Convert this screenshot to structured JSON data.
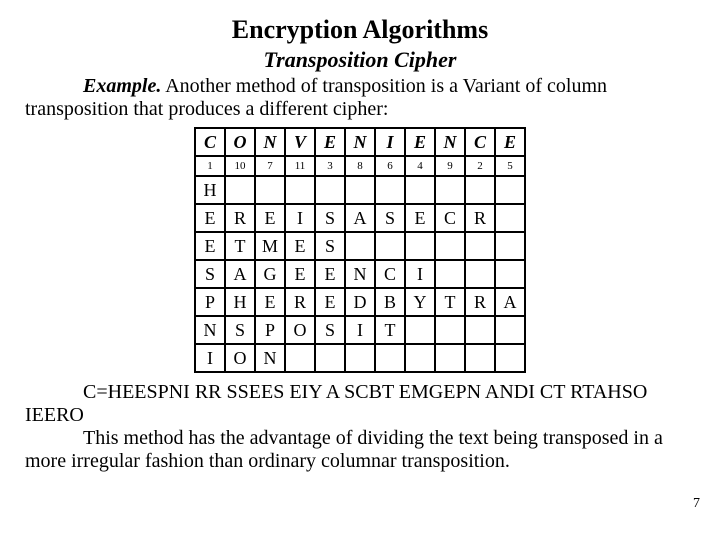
{
  "title": "Encryption Algorithms",
  "subtitle": "Transposition Cipher",
  "example_label": "Example.",
  "para1": " Another method of transposition is a Variant of column transposition that produces a different cipher:",
  "key_row": [
    "C",
    "O",
    "N",
    "V",
    "E",
    "N",
    "I",
    "E",
    "N",
    "C",
    "E"
  ],
  "num_row": [
    "1",
    "10",
    "7",
    "11",
    "3",
    "8",
    "6",
    "4",
    "9",
    "2",
    "5"
  ],
  "rows": [
    [
      "H",
      "",
      "",
      "",
      "",
      "",
      "",
      "",
      "",
      "",
      ""
    ],
    [
      "E",
      "R",
      "E",
      "I",
      "S",
      "A",
      "S",
      "E",
      "C",
      "R",
      ""
    ],
    [
      "E",
      "T",
      "M",
      "E",
      "S",
      "",
      "",
      "",
      "",
      "",
      ""
    ],
    [
      "S",
      "A",
      "G",
      "E",
      "E",
      "N",
      "C",
      "I",
      "",
      "",
      ""
    ],
    [
      "P",
      "H",
      "E",
      "R",
      "E",
      "D",
      "B",
      "Y",
      "T",
      "R",
      "A"
    ],
    [
      "N",
      "S",
      "P",
      "O",
      "S",
      "I",
      "T",
      "",
      "",
      "",
      ""
    ],
    [
      "I",
      "O",
      "N",
      "",
      "",
      "",
      "",
      "",
      "",
      "",
      ""
    ]
  ],
  "cipher_line": "C=HEESPNI RR SSEES EIY A SCBT EMGEPN ANDI CT RTAHSO IEERO",
  "para2": "This method has the advantage of dividing the text being transposed in a more irregular fashion than ordinary columnar transposition.",
  "page_number": "7"
}
